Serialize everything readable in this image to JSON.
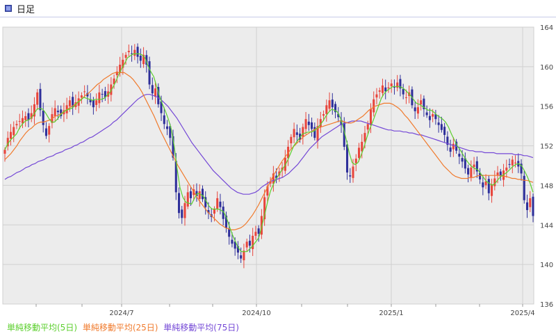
{
  "header": {
    "title": "日足"
  },
  "chart_data": {
    "type": "candlestick",
    "y_axis": {
      "min": 136,
      "max": 164,
      "position": "right",
      "ticks": [
        136,
        140,
        144,
        148,
        152,
        156,
        160,
        164
      ]
    },
    "x_axis": {
      "tick_labels": [
        "2024/7",
        "2024/10",
        "2025/1",
        "2025/4"
      ]
    },
    "grid": true,
    "up_color": "#e8453c",
    "down_color": "#2e2f9a",
    "close": [
      151.6,
      152.8,
      153.4,
      153.9,
      154.2,
      154.5,
      154.8,
      155.0,
      154.6,
      155.3,
      156.2,
      157.4,
      155.6,
      154.1,
      153.0,
      154.0,
      155.2,
      155.8,
      155.4,
      155.0,
      155.6,
      156.1,
      156.6,
      155.9,
      156.4,
      156.8,
      157.1,
      157.5,
      157.0,
      156.4,
      155.9,
      156.6,
      157.4,
      157.2,
      156.9,
      157.5,
      158.2,
      158.8,
      159.5,
      160.2,
      160.7,
      161.2,
      161.6,
      161.3,
      161.7,
      161.0,
      160.6,
      161.2,
      160.2,
      158.2,
      157.3,
      157.8,
      156.2,
      155.3,
      154.2,
      153.7,
      152.8,
      150.8,
      147.3,
      145.2,
      144.7,
      146.2,
      147.3,
      146.7,
      147.6,
      146.9,
      147.4,
      146.6,
      145.8,
      145.2,
      144.8,
      145.6,
      146.7,
      145.8,
      144.6,
      143.7,
      142.8,
      142.1,
      141.6,
      141.2,
      140.6,
      141.4,
      142.3,
      141.9,
      142.9,
      143.3,
      143.1,
      144.9,
      146.8,
      147.9,
      148.4,
      149.2,
      148.7,
      149.4,
      149.8,
      150.8,
      151.9,
      152.9,
      153.7,
      153.1,
      152.6,
      153.9,
      154.7,
      154.1,
      153.7,
      152.8,
      154.0,
      154.7,
      155.2,
      156.1,
      156.6,
      155.9,
      155.4,
      154.9,
      154.1,
      151.9,
      149.3,
      148.9,
      149.9,
      150.7,
      151.8,
      152.4,
      153.3,
      154.2,
      155.7,
      156.7,
      157.2,
      157.6,
      158.1,
      157.5,
      157.9,
      158.3,
      157.9,
      158.4,
      157.8,
      157.2,
      156.9,
      157.4,
      156.1,
      155.5,
      155.9,
      156.6,
      155.7,
      155.1,
      154.6,
      155.2,
      154.7,
      154.1,
      153.6,
      153.1,
      152.1,
      151.4,
      152.2,
      151.5,
      150.9,
      150.4,
      149.7,
      149.1,
      149.8,
      150.1,
      149.4,
      148.6,
      147.8,
      148.4,
      147.2,
      148.1,
      148.7,
      149.3,
      148.9,
      149.5,
      149.8,
      150.1,
      150.6,
      150.3,
      149.9,
      149.2,
      146.5,
      145.5,
      146.7,
      144.9
    ],
    "series": [
      {
        "name": "単純移動平均(5日)",
        "color": "#5ccf2e",
        "values": [
          151.6,
          152.2,
          152.6,
          152.9,
          153.2,
          153.8,
          154.2,
          154.5,
          154.6,
          154.8,
          155.2,
          155.7,
          155.8,
          155.7,
          155.3,
          154.8,
          154.4,
          154.4,
          154.7,
          155.1,
          155.4,
          155.6,
          155.7,
          155.8,
          156.1,
          156.4,
          156.6,
          156.9,
          156.8,
          156.7,
          156.6,
          156.7,
          156.7,
          156.7,
          156.8,
          157.1,
          157.4,
          157.9,
          158.5,
          159.2,
          159.8,
          160.3,
          160.9,
          161.1,
          161.3,
          161.3,
          161.3,
          161.2,
          160.9,
          160.1,
          159.5,
          159.0,
          158.0,
          157.0,
          156.2,
          155.5,
          154.7,
          153.7,
          152.0,
          149.7,
          147.8,
          146.8,
          146.3,
          146.2,
          146.1,
          146.7,
          147.2,
          147.1,
          146.9,
          146.4,
          145.9,
          145.6,
          145.6,
          145.6,
          145.5,
          145.3,
          144.7,
          143.8,
          143.0,
          142.3,
          141.7,
          141.3,
          141.3,
          141.3,
          141.6,
          141.9,
          142.3,
          142.7,
          143.8,
          145.0,
          146.3,
          147.4,
          148.1,
          148.7,
          149.1,
          149.6,
          150.0,
          150.6,
          151.3,
          152.0,
          152.4,
          152.8,
          153.2,
          153.3,
          153.4,
          153.4,
          153.5,
          153.8,
          154.1,
          154.5,
          155.0,
          155.4,
          155.7,
          155.6,
          155.4,
          154.8,
          153.8,
          152.6,
          151.3,
          150.3,
          150.1,
          150.3,
          151.0,
          151.8,
          152.8,
          153.7,
          154.4,
          155.2,
          156.0,
          156.8,
          157.3,
          157.6,
          157.8,
          158.0,
          158.0,
          158.0,
          157.9,
          157.7,
          157.4,
          157.1,
          156.7,
          156.3,
          156.2,
          156.0,
          155.8,
          155.6,
          155.6,
          155.4,
          155.1,
          154.9,
          154.7,
          154.4,
          153.9,
          153.2,
          152.6,
          152.0,
          151.6,
          151.1,
          150.6,
          150.2,
          149.9,
          149.7,
          149.6,
          149.2,
          148.8,
          148.4,
          148.2,
          148.0,
          148.2,
          148.6,
          148.9,
          149.1,
          149.3,
          149.6,
          149.9,
          150.1,
          150.2,
          150.0,
          149.5,
          148.9,
          148.2,
          147.3
        ]
      },
      {
        "name": "単純移動平均(25日)",
        "color": "#f07a2c",
        "values": [
          150.6,
          150.9,
          151.2,
          151.6,
          152.0,
          152.5,
          152.9,
          153.3,
          153.6,
          153.8,
          154.1,
          154.3,
          154.4,
          154.4,
          154.5,
          154.6,
          154.8,
          155.0,
          155.1,
          155.3,
          155.5,
          155.7,
          155.9,
          156.1,
          156.3,
          156.6,
          156.8,
          157.1,
          157.3,
          157.6,
          157.9,
          158.2,
          158.4,
          158.7,
          158.9,
          159.1,
          159.3,
          159.4,
          159.4,
          159.4,
          159.4,
          159.2,
          159.0,
          158.7,
          158.3,
          157.9,
          157.4,
          156.8,
          156.2,
          155.6,
          155.0,
          154.3,
          153.6,
          153.0,
          152.4,
          151.8,
          151.2,
          150.6,
          150.0,
          149.5,
          149.0,
          148.5,
          148.0,
          147.5,
          147.0,
          146.5,
          146.1,
          145.7,
          145.3,
          145.0,
          144.7,
          144.4,
          144.1,
          143.9,
          143.7,
          143.6,
          143.5,
          143.5,
          143.6,
          143.7,
          143.9,
          144.2,
          144.6,
          145.0,
          145.5,
          146.0,
          146.6,
          147.2,
          147.8,
          148.4,
          149.0,
          149.5,
          150.0,
          150.5,
          150.9,
          151.3,
          151.7,
          152.0,
          152.3,
          152.6,
          152.9,
          153.1,
          153.3,
          153.5,
          153.7,
          153.8,
          153.9,
          154.0,
          154.1,
          154.2,
          154.3,
          154.4,
          154.5,
          154.5,
          154.4,
          154.3,
          154.3,
          154.4,
          154.6,
          154.8,
          155.0,
          155.3,
          155.6,
          155.8,
          156.0,
          156.1,
          156.2,
          156.3,
          156.3,
          156.3,
          156.2,
          156.0,
          155.8,
          155.5,
          155.1,
          154.8,
          154.4,
          154.0,
          153.6,
          153.2,
          152.8,
          152.4,
          152.0,
          151.6,
          151.2,
          150.8,
          150.4,
          150.0,
          149.7,
          149.4,
          149.1,
          148.9,
          148.8,
          148.7,
          148.7,
          148.7,
          148.8,
          148.8,
          148.9,
          149.0,
          149.0,
          149.0,
          149.0,
          149.0,
          149.0,
          149.0,
          149.0,
          148.9,
          148.9,
          148.8,
          148.7,
          148.7,
          148.6,
          148.6,
          148.5,
          148.5,
          148.4,
          148.3
        ]
      },
      {
        "name": "単純移動平均(75日)",
        "color": "#7448d6",
        "values": [
          148.6,
          148.8,
          148.9,
          149.1,
          149.3,
          149.4,
          149.6,
          149.8,
          149.9,
          150.1,
          150.2,
          150.4,
          150.5,
          150.6,
          150.8,
          150.9,
          151.0,
          151.2,
          151.3,
          151.4,
          151.6,
          151.7,
          151.8,
          152.0,
          152.1,
          152.3,
          152.4,
          152.6,
          152.8,
          152.9,
          153.1,
          153.3,
          153.5,
          153.7,
          153.9,
          154.1,
          154.4,
          154.6,
          154.9,
          155.2,
          155.5,
          155.8,
          156.1,
          156.4,
          156.7,
          156.9,
          157.1,
          157.2,
          157.2,
          157.1,
          157.0,
          156.8,
          156.6,
          156.3,
          156.0,
          155.6,
          155.2,
          154.8,
          154.3,
          153.8,
          153.3,
          152.8,
          152.3,
          151.9,
          151.5,
          151.1,
          150.7,
          150.3,
          149.9,
          149.5,
          149.2,
          148.9,
          148.6,
          148.3,
          148.0,
          147.7,
          147.5,
          147.3,
          147.2,
          147.1,
          147.1,
          147.1,
          147.2,
          147.3,
          147.5,
          147.8,
          148.0,
          148.2,
          148.4,
          148.5,
          148.6,
          148.7,
          148.8,
          149.0,
          149.2,
          149.5,
          149.8,
          150.1,
          150.5,
          150.9,
          151.3,
          151.7,
          152.0,
          152.3,
          152.6,
          152.9,
          153.1,
          153.3,
          153.5,
          153.7,
          153.9,
          154.1,
          154.2,
          154.3,
          154.4,
          154.5,
          154.5,
          154.5,
          154.5,
          154.4,
          154.3,
          154.2,
          154.1,
          154.0,
          153.9,
          153.8,
          153.7,
          153.6,
          153.6,
          153.5,
          153.5,
          153.5,
          153.4,
          153.4,
          153.3,
          153.3,
          153.2,
          153.1,
          153.1,
          153.0,
          152.9,
          152.8,
          152.7,
          152.6,
          152.5,
          152.4,
          152.3,
          152.2,
          152.1,
          152.0,
          151.9,
          151.8,
          151.7,
          151.6,
          151.5,
          151.5,
          151.4,
          151.4,
          151.4,
          151.3,
          151.3,
          151.3,
          151.3,
          151.2,
          151.2,
          151.2,
          151.2,
          151.2,
          151.2,
          151.1,
          151.1,
          151.1,
          151.0,
          151.0,
          150.9,
          150.8
        ]
      }
    ]
  }
}
